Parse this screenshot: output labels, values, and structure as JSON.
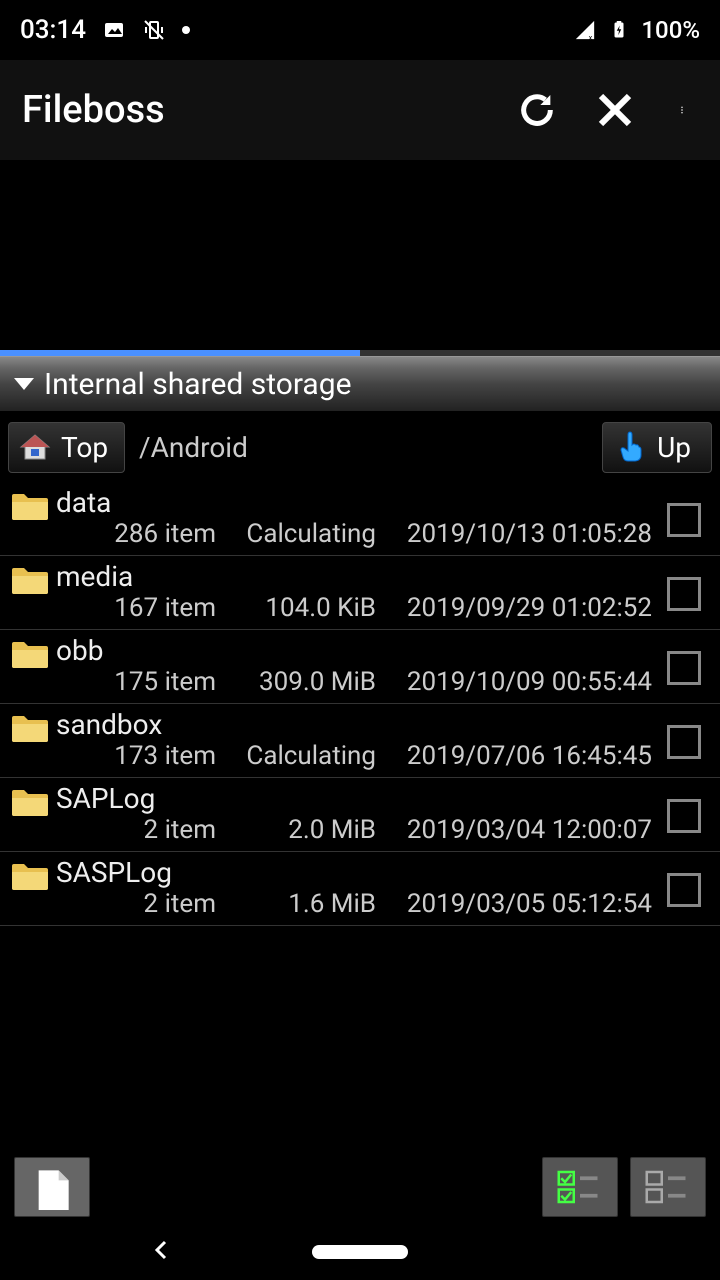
{
  "status": {
    "time": "03:14",
    "battery": "100%"
  },
  "appbar": {
    "title": "Fileboss"
  },
  "section": {
    "title": "Internal shared storage"
  },
  "path": {
    "top_label": "Top",
    "current": "/Android",
    "up_label": "Up"
  },
  "files": [
    {
      "name": "data",
      "items": "286 item",
      "size": "Calculating",
      "date": "2019/10/13 01:05:28"
    },
    {
      "name": "media",
      "items": "167 item",
      "size": "104.0 KiB",
      "date": "2019/09/29 01:02:52"
    },
    {
      "name": "obb",
      "items": "175 item",
      "size": "309.0 MiB",
      "date": "2019/10/09 00:55:44"
    },
    {
      "name": "sandbox",
      "items": "173 item",
      "size": "Calculating",
      "date": "2019/07/06 16:45:45"
    },
    {
      "name": "SAPLog",
      "items": "2 item",
      "size": "2.0 MiB",
      "date": "2019/03/04 12:00:07"
    },
    {
      "name": "SASPLog",
      "items": "2 item",
      "size": "1.6 MiB",
      "date": "2019/03/05 05:12:54"
    }
  ]
}
